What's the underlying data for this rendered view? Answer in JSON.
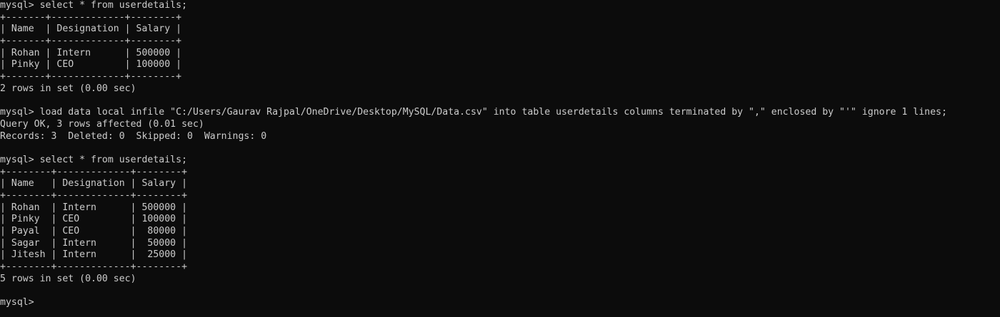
{
  "colors": {
    "background": "#0c0c0c",
    "foreground": "#cccccc"
  },
  "lines": [
    "mysql> select * from userdetails;",
    "+-------+-------------+--------+",
    "| Name  | Designation | Salary |",
    "+-------+-------------+--------+",
    "| Rohan | Intern      | 500000 |",
    "| Pinky | CEO         | 100000 |",
    "+-------+-------------+--------+",
    "2 rows in set (0.00 sec)",
    "",
    "mysql> load data local infile \"C:/Users/Gaurav Rajpal/OneDrive/Desktop/MySQL/Data.csv\" into table userdetails columns terminated by \",\" enclosed by \"'\" ignore 1 lines;",
    "Query OK, 3 rows affected (0.01 sec)",
    "Records: 3  Deleted: 0  Skipped: 0  Warnings: 0",
    "",
    "mysql> select * from userdetails;",
    "+--------+-------------+--------+",
    "| Name   | Designation | Salary |",
    "+--------+-------------+--------+",
    "| Rohan  | Intern      | 500000 |",
    "| Pinky  | CEO         | 100000 |",
    "| Payal  | CEO         |  80000 |",
    "| Sagar  | Intern      |  50000 |",
    "| Jitesh | Intern      |  25000 |",
    "+--------+-------------+--------+",
    "5 rows in set (0.00 sec)",
    "",
    "mysql>"
  ]
}
